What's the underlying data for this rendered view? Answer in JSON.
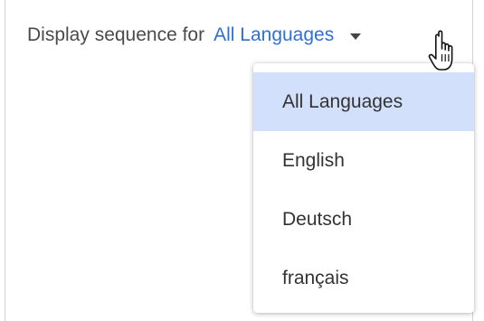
{
  "header": {
    "label": "Display sequence for",
    "selected_value": "All Languages"
  },
  "dropdown": {
    "selected_index": 0,
    "options": [
      {
        "label": "All Languages"
      },
      {
        "label": "English"
      },
      {
        "label": "Deutsch"
      },
      {
        "label": "français"
      }
    ]
  },
  "colors": {
    "accent_link": "#2f6fd6",
    "selected_option_bg": "#d3e0fb",
    "text": "#4a4a4a"
  },
  "icons": {
    "caret": "caret-down-icon",
    "cursor": "hand-pointer-cursor-icon"
  }
}
